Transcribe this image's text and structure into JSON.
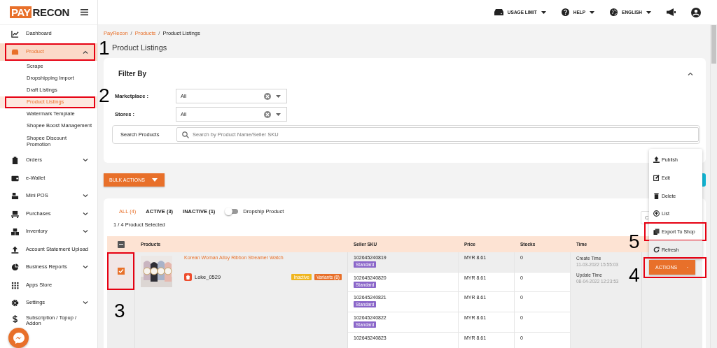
{
  "logo": {
    "part1": "PAY",
    "part2": "RECON"
  },
  "topbar": {
    "items": [
      {
        "label": "USAGE LIMIT"
      },
      {
        "label": "HELP"
      },
      {
        "label": "ENGLISH"
      }
    ]
  },
  "sidebar": {
    "items": [
      {
        "label": "Dashboard",
        "selected": false,
        "highlighted": false
      },
      {
        "label": "Product",
        "selected": true,
        "highlighted": true,
        "expanded": true,
        "children": [
          {
            "label": "Scrape",
            "selected": false,
            "highlighted": false
          },
          {
            "label": "Dropshipping Import",
            "selected": false,
            "highlighted": false
          },
          {
            "label": "Draft Listings",
            "selected": false,
            "highlighted": false
          },
          {
            "label": "Product Listings",
            "selected": true,
            "highlighted": true
          },
          {
            "label": "Watermark Template",
            "selected": false,
            "highlighted": false
          },
          {
            "label": "Shopee Boost Management",
            "selected": false,
            "highlighted": false
          },
          {
            "label": "Shopee Discount Promotion",
            "selected": false,
            "highlighted": false
          }
        ]
      },
      {
        "label": "Orders",
        "selected": false,
        "highlighted": false,
        "expanded": false
      },
      {
        "label": "e-Wallet",
        "selected": false,
        "highlighted": false
      },
      {
        "label": "Mini POS",
        "selected": false,
        "highlighted": false,
        "expanded": false
      },
      {
        "label": "Purchases",
        "selected": false,
        "highlighted": false,
        "expanded": false
      },
      {
        "label": "Inventory",
        "selected": false,
        "highlighted": false,
        "expanded": false
      },
      {
        "label": "Account Statement Upload",
        "selected": false,
        "highlighted": false
      },
      {
        "label": "Business Reports",
        "selected": false,
        "highlighted": false,
        "expanded": false
      },
      {
        "label": "Apps Store",
        "selected": false,
        "highlighted": false
      },
      {
        "label": "Settings",
        "selected": false,
        "highlighted": false,
        "expanded": false
      },
      {
        "label": "Subscription / Topup / Addon",
        "selected": false,
        "highlighted": false
      }
    ]
  },
  "breadcrumb": {
    "separator": "/",
    "items": [
      {
        "label": "PayRecon"
      },
      {
        "label": "Products"
      },
      {
        "label": "Product Listings"
      }
    ]
  },
  "page_title": "Product Listings",
  "filter": {
    "title": "Filter By",
    "expanded": true,
    "selects": [
      {
        "label": "Marketplace :",
        "value": "All"
      },
      {
        "label": "Stores :",
        "value": "All"
      }
    ],
    "search": {
      "label": "Search Products",
      "placeholder": "Search by Product Name/Seller SKU"
    }
  },
  "bulk_actions": "BULK ACTIONS",
  "tabs": [
    {
      "label": "ALL (4)",
      "selected": true
    },
    {
      "label": "ACTIVE (3)",
      "selected": false
    },
    {
      "label": "INACTIVE (1)",
      "selected": false
    }
  ],
  "dropship_toggle": {
    "label": "Dropship Product",
    "on": false
  },
  "selection_count": "1 / 4 Product Selected",
  "table_search": {
    "placeholder": "C"
  },
  "table": {
    "select_all_indeterminate": true,
    "columns": [
      "Products",
      "Seller SKU",
      "Price",
      "Stocks",
      "Time"
    ],
    "product": {
      "name": "Korean Woman Alloy Ribbon Streamer Watch",
      "store": "Loke_0529",
      "checked": true,
      "highlighted": true,
      "tags": [
        {
          "label": "Inactive",
          "color": "#f0b620"
        },
        {
          "label": "Variants (8)",
          "color": "#e8702a"
        }
      ],
      "variants": [
        {
          "sku": "102645240819",
          "type": "Standard",
          "price": "MYR 8.61",
          "stocks": "0",
          "hovered": true
        },
        {
          "sku": "102645240820",
          "type": "Standard",
          "price": "MYR 8.61",
          "stocks": "0",
          "hovered": false
        },
        {
          "sku": "102645240821",
          "type": "Standard",
          "price": "MYR 8.61",
          "stocks": "0",
          "hovered": false
        },
        {
          "sku": "102645240822",
          "type": "Standard",
          "price": "MYR 8.61",
          "stocks": "0",
          "hovered": false
        },
        {
          "sku": "102645240823",
          "price": "MYR 8.61",
          "stocks": "0",
          "hovered": false
        }
      ],
      "create_label": "Create Time",
      "create_time": "11-03-2022 15:55:03",
      "update_label": "Update Time",
      "update_time": "08-04-2022 12:23:53"
    }
  },
  "actions": {
    "label": "ACTIONS",
    "highlighted": true,
    "menu": [
      {
        "label": "Publish",
        "highlighted": false
      },
      {
        "label": "Edit",
        "highlighted": false
      },
      {
        "label": "Delete",
        "highlighted": false
      },
      {
        "label": "List",
        "highlighted": false
      },
      {
        "label": "Export To Shop",
        "highlighted": true
      },
      {
        "label": "Refresh",
        "highlighted": false
      }
    ]
  },
  "callouts": [
    {
      "label": "1"
    },
    {
      "label": "2"
    },
    {
      "label": "3"
    },
    {
      "label": "4"
    },
    {
      "label": "5"
    }
  ]
}
